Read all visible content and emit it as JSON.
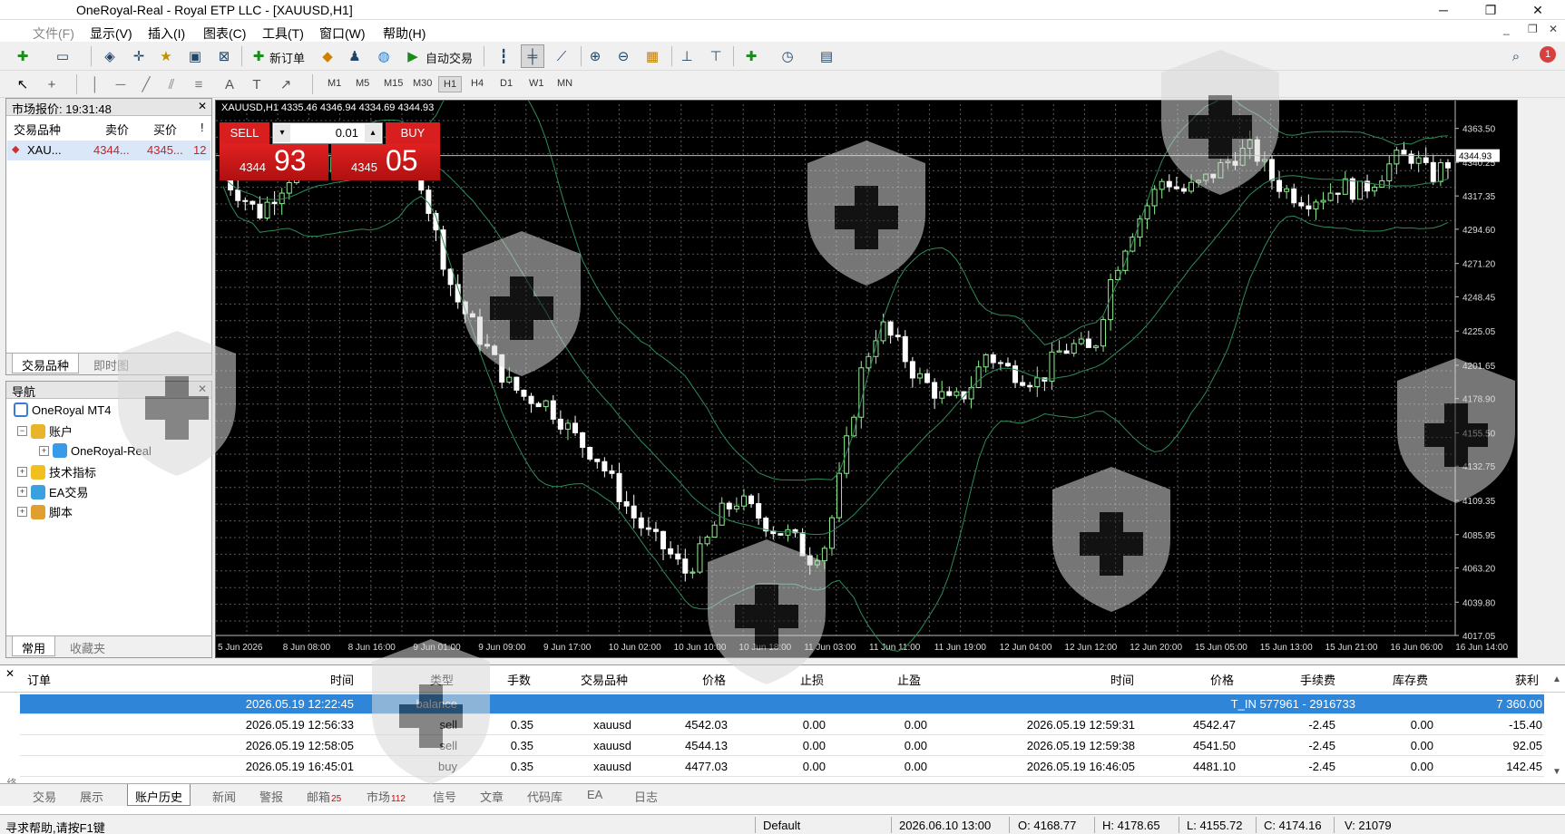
{
  "window": {
    "title": "OneRoyal-Real - Royal ETP LLC - [XAUUSD,H1]"
  },
  "menu": [
    "文件(F)",
    "显示(V)",
    "插入(I)",
    "图表(C)",
    "工具(T)",
    "窗口(W)",
    "帮助(H)"
  ],
  "toolbar": {
    "new_order": "新订单",
    "auto_trade": "自动交易"
  },
  "timeframes": [
    "M1",
    "M5",
    "M15",
    "M30",
    "H1",
    "H4",
    "D1",
    "W1",
    "MN"
  ],
  "selected_timeframe": "H1",
  "market_watch": {
    "title": "市场报价: 19:31:48",
    "columns": [
      "交易品种",
      "卖价",
      "买价",
      "!"
    ],
    "rows": [
      {
        "symbol": "XAU...",
        "bid": "4344...",
        "ask": "4345...",
        "spread": "12"
      }
    ],
    "tabs": [
      "交易品种",
      "即时图"
    ]
  },
  "navigator": {
    "title": "导航",
    "items": {
      "root": "OneRoyal MT4",
      "accounts": "账户",
      "account": "OneRoyal-Real",
      "indicators": "技术指标",
      "ea": "EA交易",
      "scripts": "脚本"
    },
    "tabs": [
      "常用",
      "收藏夹"
    ]
  },
  "chart": {
    "header": "XAUUSD,H1  4335.46 4346.94 4334.69 4344.93",
    "one_click": {
      "sell_label": "SELL",
      "buy_label": "BUY",
      "lots": "0.01",
      "sell_big": "93",
      "sell_small": "4344",
      "buy_big": "05",
      "buy_small": "4345"
    },
    "current_price_label": "4344.93",
    "price_labels": [
      "4363.50",
      "4340.25",
      "4317.35",
      "4294.60",
      "4271.20",
      "4248.45",
      "4225.05",
      "4201.65",
      "4178.90",
      "4155.50",
      "4132.75",
      "4109.35",
      "4085.95",
      "4063.20",
      "4039.80",
      "4017.05"
    ],
    "time_labels": [
      "5 Jun 2026",
      "8 Jun 08:00",
      "8 Jun 16:00",
      "9 Jun 01:00",
      "9 Jun 09:00",
      "9 Jun 17:00",
      "10 Jun 02:00",
      "10 Jun 10:00",
      "10 Jun 18:00",
      "11 Jun 03:00",
      "11 Jun 11:00",
      "11 Jun 19:00",
      "12 Jun 04:00",
      "12 Jun 12:00",
      "12 Jun 20:00",
      "15 Jun 05:00",
      "15 Jun 13:00",
      "15 Jun 21:00",
      "16 Jun 06:00",
      "16 Jun 14:00"
    ]
  },
  "chart_data": {
    "type": "candlestick",
    "symbol": "XAUUSD",
    "timeframe": "H1",
    "ylim": [
      4017.05,
      4380
    ],
    "grid": true,
    "close_path": [
      4330,
      4318,
      4305,
      4320,
      4335,
      4345,
      4338,
      4340,
      4348,
      4342,
      4345,
      4335,
      4290,
      4250,
      4230,
      4210,
      4190,
      4180,
      4178,
      4165,
      4150,
      4140,
      4120,
      4100,
      4085,
      4075,
      4060,
      4075,
      4100,
      4110,
      4100,
      4090,
      4085,
      4070,
      4080,
      4140,
      4200,
      4230,
      4215,
      4195,
      4185,
      4175,
      4185,
      4210,
      4200,
      4195,
      4190,
      4210,
      4215,
      4210,
      4260,
      4290,
      4310,
      4330,
      4320,
      4325,
      4335,
      4345,
      4350,
      4330,
      4320,
      4315,
      4318,
      4325,
      4320,
      4330,
      4342,
      4345,
      4330,
      4340
    ]
  },
  "terminal": {
    "columns": [
      "订单",
      "时间",
      "类型",
      "手数",
      "交易品种",
      "价格",
      "止损",
      "止盈",
      "时间",
      "价格",
      "手续费",
      "库存费",
      "获利"
    ],
    "rows": [
      {
        "order": "",
        "time": "2026.05.19 12:22:45",
        "type": "balance",
        "size": "",
        "symbol": "",
        "price": "",
        "sl": "",
        "tp": "",
        "close_time": "",
        "close_price": "",
        "commission": "T_IN 577961 - 2916733",
        "swap": "",
        "profit": "7 360.00"
      },
      {
        "order": "",
        "time": "2026.05.19 12:56:33",
        "type": "sell",
        "size": "0.35",
        "symbol": "xauusd",
        "price": "4542.03",
        "sl": "0.00",
        "tp": "0.00",
        "close_time": "2026.05.19 12:59:31",
        "close_price": "4542.47",
        "commission": "-2.45",
        "swap": "0.00",
        "profit": "-15.40"
      },
      {
        "order": "",
        "time": "2026.05.19 12:58:05",
        "type": "sell",
        "size": "0.35",
        "symbol": "xauusd",
        "price": "4544.13",
        "sl": "0.00",
        "tp": "0.00",
        "close_time": "2026.05.19 12:59:38",
        "close_price": "4541.50",
        "commission": "-2.45",
        "swap": "0.00",
        "profit": "92.05"
      },
      {
        "order": "",
        "time": "2026.05.19 16:45:01",
        "type": "buy",
        "size": "0.35",
        "symbol": "xauusd",
        "price": "4477.03",
        "sl": "0.00",
        "tp": "0.00",
        "close_time": "2026.05.19 16:46:05",
        "close_price": "4481.10",
        "commission": "-2.45",
        "swap": "0.00",
        "profit": "142.45"
      }
    ],
    "side_label": "终端",
    "tabs": [
      {
        "label": "交易",
        "badge": ""
      },
      {
        "label": "展示",
        "badge": ""
      },
      {
        "label": "账户历史",
        "badge": ""
      },
      {
        "label": "新闻",
        "badge": ""
      },
      {
        "label": "警报",
        "badge": ""
      },
      {
        "label": "邮箱",
        "badge": "25"
      },
      {
        "label": "市场",
        "badge": "112"
      },
      {
        "label": "信号",
        "badge": ""
      },
      {
        "label": "文章",
        "badge": ""
      },
      {
        "label": "代码库",
        "badge": ""
      },
      {
        "label": "EA",
        "badge": ""
      },
      {
        "label": "日志",
        "badge": ""
      }
    ],
    "active_tab": "账户历史"
  },
  "status": {
    "help": "寻求帮助,请按F1键",
    "profile": "Default",
    "datetime": "2026.06.10 13:00",
    "open": "O: 4168.77",
    "high": "H: 4178.65",
    "low": "L: 4155.72",
    "close": "C: 4174.16",
    "volume": "V: 21079"
  },
  "colors": {
    "bull": "#90ee90",
    "bear": "#ffffff",
    "band": "#2e8b57",
    "sell": "#d81e1e",
    "buy": "#d81e1e",
    "selection": "#2f86d8"
  },
  "notifications": {
    "badge": "1"
  }
}
